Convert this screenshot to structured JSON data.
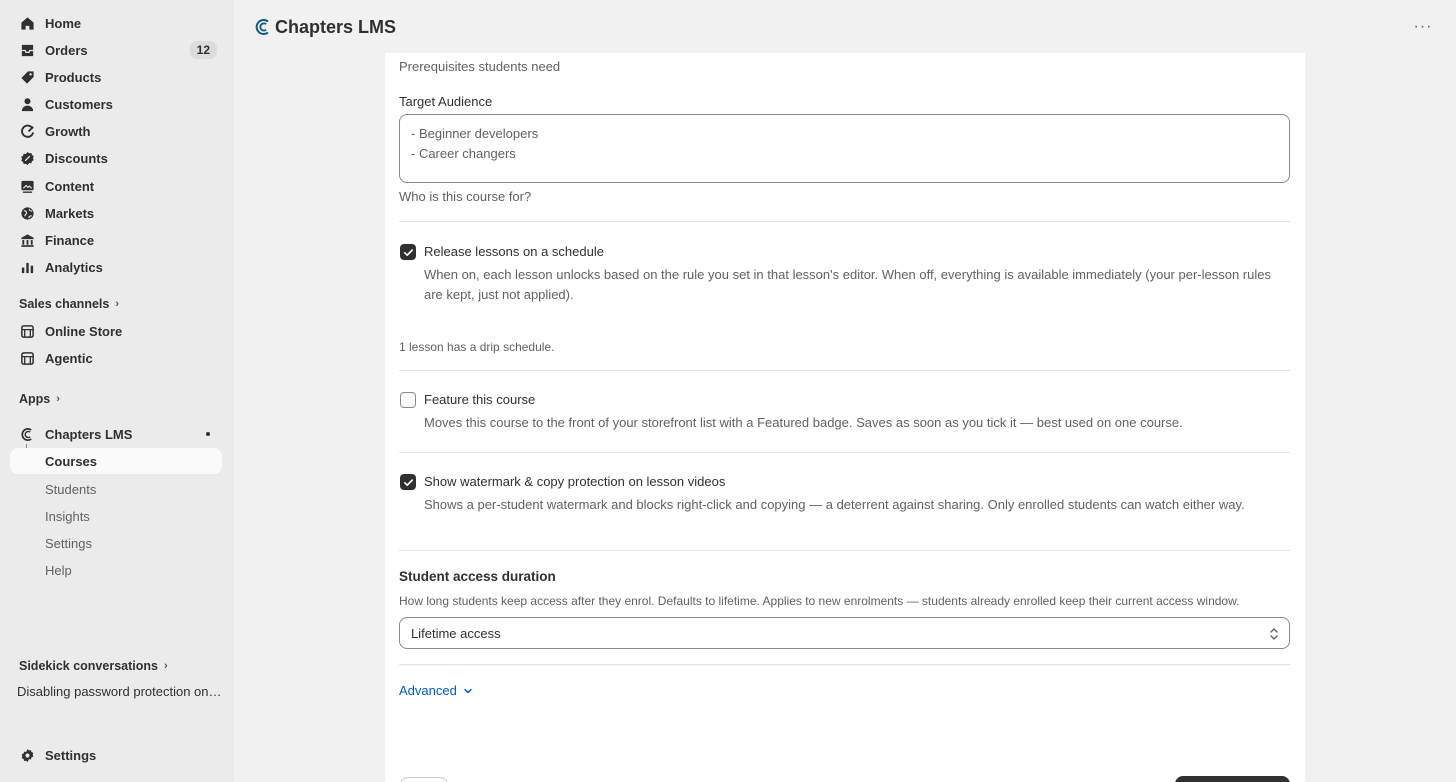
{
  "sidebar": {
    "nav": [
      {
        "label": "Home",
        "icon": "home-icon"
      },
      {
        "label": "Orders",
        "icon": "orders-icon",
        "badge": "12"
      },
      {
        "label": "Products",
        "icon": "tag-icon"
      },
      {
        "label": "Customers",
        "icon": "person-icon"
      },
      {
        "label": "Growth",
        "icon": "growth-icon"
      },
      {
        "label": "Discounts",
        "icon": "discount-icon"
      },
      {
        "label": "Content",
        "icon": "content-icon"
      },
      {
        "label": "Markets",
        "icon": "globe-icon"
      },
      {
        "label": "Finance",
        "icon": "bank-icon"
      },
      {
        "label": "Analytics",
        "icon": "bar-chart-icon"
      }
    ],
    "sales_channels": {
      "heading": "Sales channels",
      "items": [
        {
          "label": "Online Store",
          "icon": "store-icon"
        },
        {
          "label": "Agentic",
          "icon": "store-icon"
        }
      ]
    },
    "apps": {
      "heading": "Apps",
      "app_name": "Chapters LMS",
      "sub_items": [
        "Courses",
        "Students",
        "Insights",
        "Settings",
        "Help"
      ],
      "active": "Courses"
    },
    "sidekick": {
      "heading": "Sidekick conversations",
      "item": "Disabling password protection on the online store"
    },
    "settings_label": "Settings"
  },
  "header": {
    "title": "Chapters LMS",
    "more": "···"
  },
  "form": {
    "prereq_help": "Prerequisites students need",
    "target_audience": {
      "label": "Target Audience",
      "lines": [
        "- Beginner developers",
        "- Career changers"
      ],
      "help": "Who is this course for?"
    },
    "release_schedule": {
      "checked": true,
      "label": "Release lessons on a schedule",
      "help": "When on, each lesson unlocks based on the rule you set in that lesson's editor. When off, everything is available immediately (your per-lesson rules are kept, just not applied).",
      "note": "1 lesson has a drip schedule."
    },
    "feature_course": {
      "checked": false,
      "label": "Feature this course",
      "help": "Moves this course to the front of your storefront list with a Featured badge. Saves as soon as you tick it — best used on one course."
    },
    "watermark": {
      "checked": true,
      "label": "Show watermark & copy protection on lesson videos",
      "help": "Shows a per-student watermark and blocks right-click and copying — a deterrent against sharing. Only enrolled students can watch either way."
    },
    "access_duration": {
      "title": "Student access duration",
      "help": "How long students keep access after they enrol. Defaults to lifetime. Applies to new enrolments — students already enrolled keep their current access window.",
      "value": "Lifetime access"
    },
    "advanced_label": "Advanced"
  },
  "colors": {
    "sidebar_bg": "#ebebeb",
    "page_bg": "#f1f1f1",
    "card_bg": "#ffffff",
    "link": "#005bd3",
    "checkbox_on": "#303030",
    "logo": "#0b5c8a"
  }
}
